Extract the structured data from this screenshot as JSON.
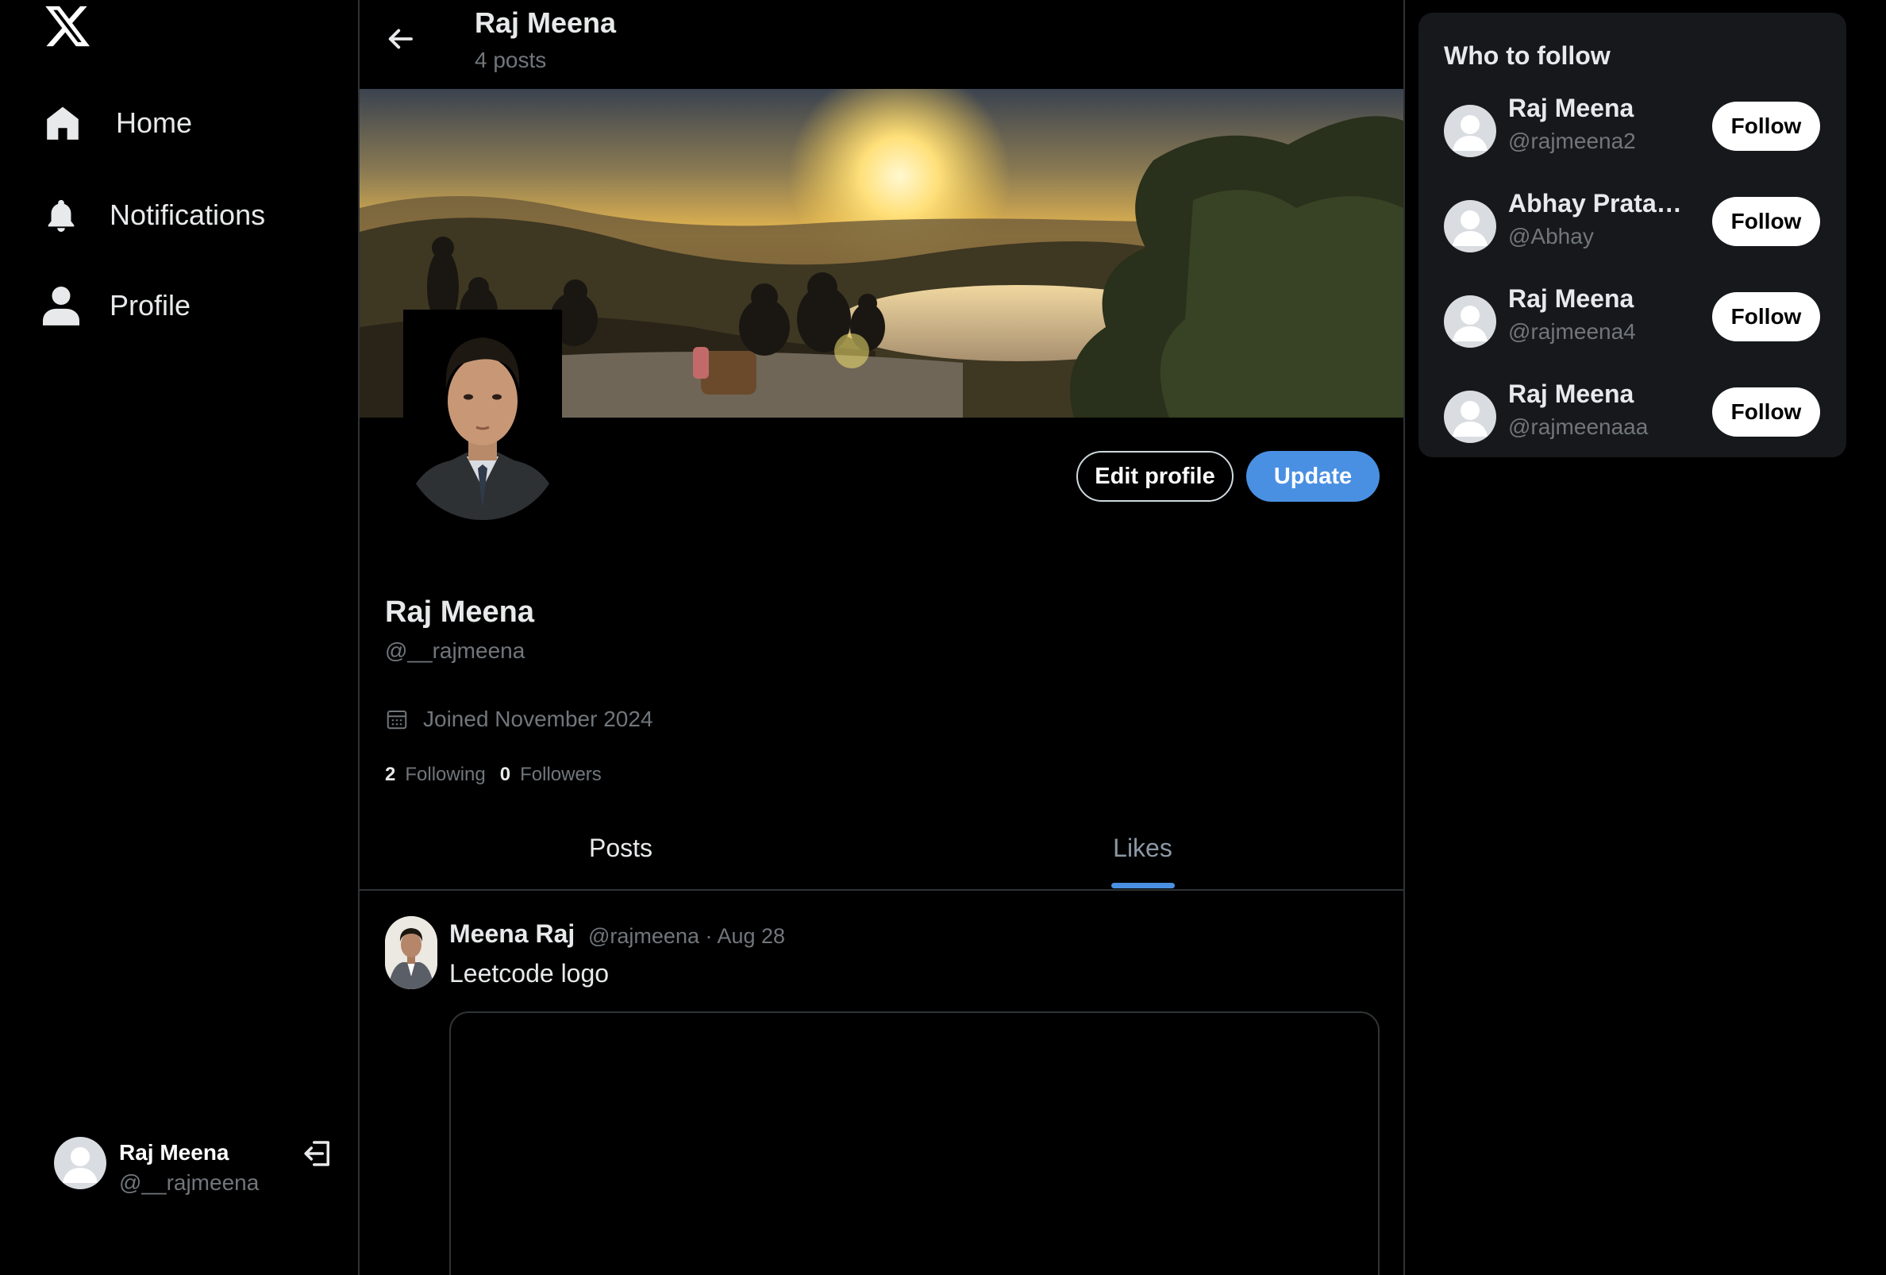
{
  "nav": {
    "items": [
      {
        "label": "Home",
        "icon": "home-icon"
      },
      {
        "label": "Notifications",
        "icon": "bell-icon"
      },
      {
        "label": "Profile",
        "icon": "user-icon"
      }
    ]
  },
  "current_user": {
    "name": "Raj Meena",
    "handle": "@__rajmeena"
  },
  "header": {
    "title": "Raj Meena",
    "subtitle": "4 posts"
  },
  "profile": {
    "name": "Raj Meena",
    "handle": "@__rajmeena",
    "joined": "Joined November 2024",
    "following_count": "2",
    "following_label": "Following",
    "followers_count": "0",
    "followers_label": "Followers",
    "edit_label": "Edit profile",
    "update_label": "Update"
  },
  "tabs": [
    {
      "label": "Posts",
      "active": false
    },
    {
      "label": "Likes",
      "active": true
    }
  ],
  "post": {
    "author": "Meena Raj",
    "meta": "@rajmeena · Aug 28",
    "text": "Leetcode logo"
  },
  "who_to_follow": {
    "title": "Who to follow",
    "follow_label": "Follow",
    "users": [
      {
        "name": "Raj Meena",
        "handle": "@rajmeena2"
      },
      {
        "name": "Abhay Pratap...",
        "handle": "@Abhay"
      },
      {
        "name": "Raj Meena",
        "handle": "@rajmeena4"
      },
      {
        "name": "Raj Meena",
        "handle": "@rajmeenaaa"
      }
    ]
  },
  "colors": {
    "accent": "#4a90e2",
    "background": "#000000",
    "muted_text": "#71767b",
    "panel": "#16181c"
  }
}
